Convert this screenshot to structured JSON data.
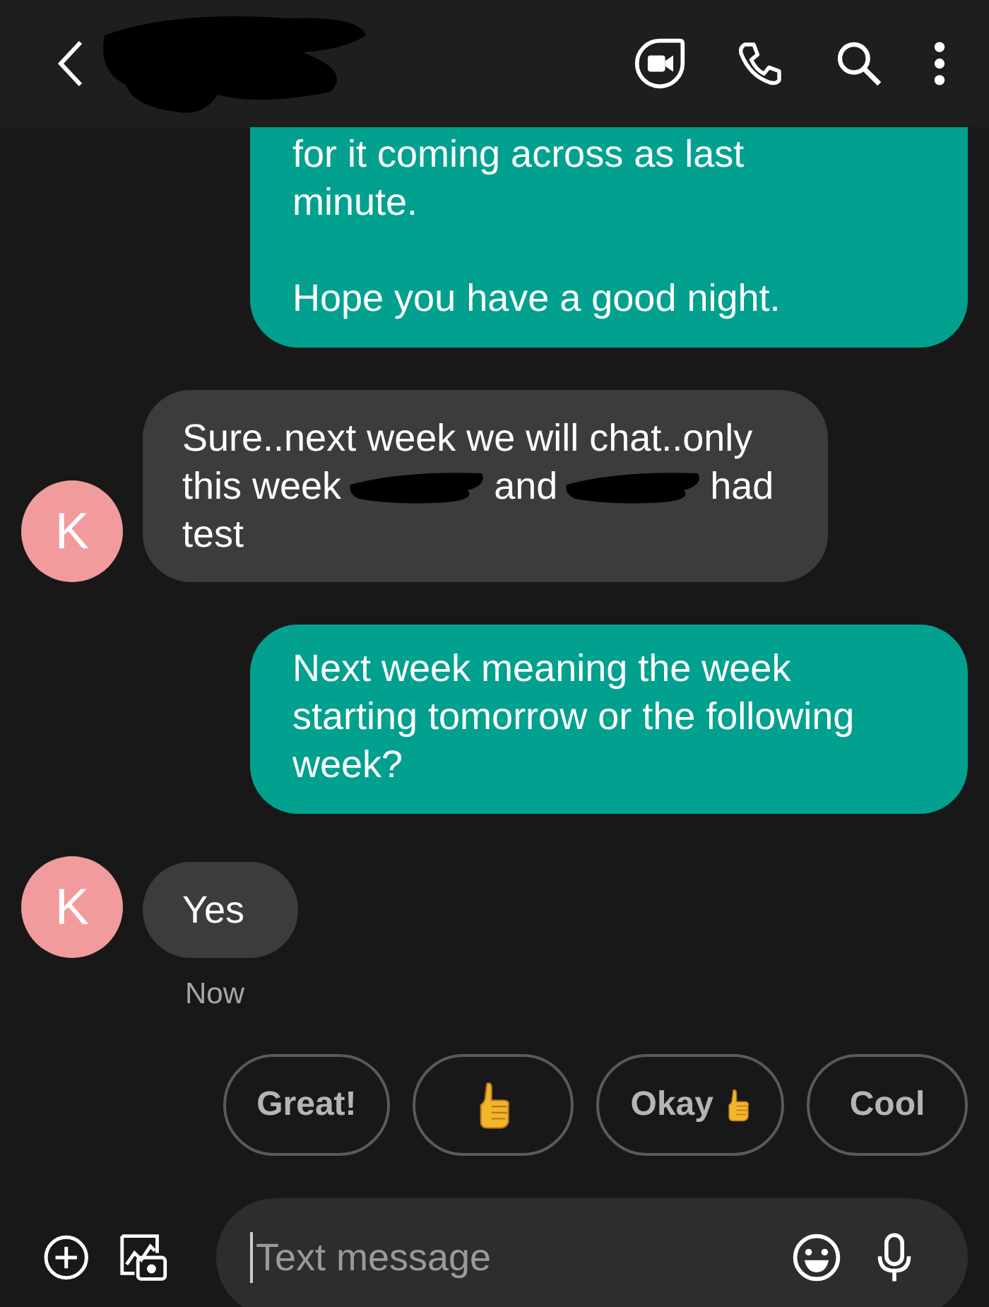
{
  "header": {
    "name_redacted": true
  },
  "messages": [
    {
      "kind": "outgoing",
      "paragraphs": [
        [
          "for it coming across as last",
          "minute."
        ],
        [
          "Hope you have a good night."
        ]
      ],
      "cut_top": true
    },
    {
      "kind": "incoming",
      "avatar": "K",
      "lines": [
        [
          {
            "kind": "text",
            "text": "Sure..next week we will chat..only"
          }
        ],
        [
          {
            "kind": "text",
            "text": "this week"
          },
          {
            "kind": "redacted"
          },
          {
            "kind": "text",
            "text": "and"
          },
          {
            "kind": "redacted"
          },
          {
            "kind": "text",
            "text": "had"
          }
        ],
        [
          {
            "kind": "text",
            "text": "test"
          }
        ]
      ]
    },
    {
      "kind": "outgoing",
      "paragraphs": [
        [
          "Next week meaning the week",
          "starting tomorrow or the following",
          "week?"
        ]
      ],
      "cut_top": false
    },
    {
      "kind": "incoming",
      "avatar": "K",
      "lines": [
        [
          {
            "kind": "text",
            "text": "Yes"
          }
        ]
      ],
      "time": "Now"
    }
  ],
  "suggestions": [
    {
      "kind": "text",
      "label": "Great!"
    },
    {
      "kind": "thumb"
    },
    {
      "kind": "text_thumb",
      "label": "Okay"
    },
    {
      "kind": "text",
      "label": "Cool"
    }
  ],
  "composer": {
    "placeholder": "Text message"
  }
}
